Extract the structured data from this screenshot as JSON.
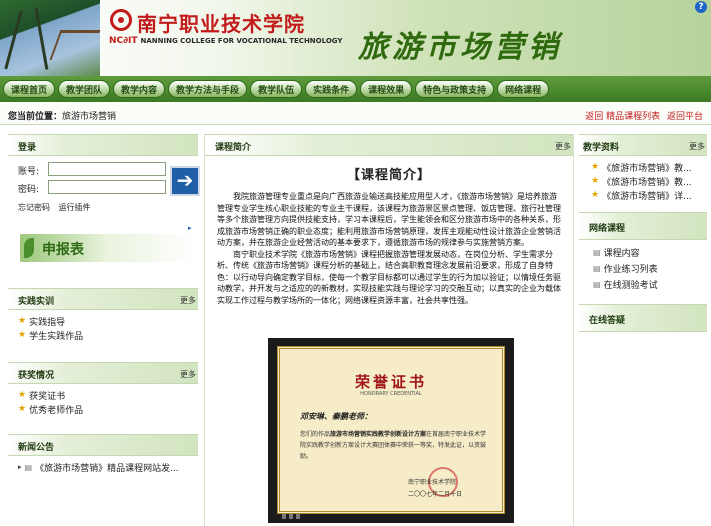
{
  "header": {
    "school_name_cn": "南宁职业技术学院",
    "school_brand": "NC∂IT",
    "school_name_en": "NANNING COLLEGE FOR VOCATIONAL TECHNOLOGY",
    "course_title": "旅游市场营销",
    "help_label": "?"
  },
  "nav": {
    "items": [
      "课程首页",
      "教学团队",
      "教学内容",
      "教学方法与手段",
      "教学队伍",
      "实践条件",
      "课程效果",
      "特色与政策支持",
      "网络课程"
    ]
  },
  "location": {
    "label": "您当前位置：",
    "current": "旅游市场营销",
    "links": [
      "返回 精品课程列表",
      "返回平台"
    ]
  },
  "login": {
    "title": "登录",
    "username_label": "账号:",
    "password_label": "密码:",
    "username_value": "",
    "password_value": "",
    "go_label": "➔",
    "links": [
      "忘记密码",
      "运行插件"
    ]
  },
  "apply": {
    "label": "申报表",
    "arrow": "▸"
  },
  "practice": {
    "title": "实践实训",
    "more": "更多",
    "items": [
      "实践指导",
      "学生实践作品"
    ]
  },
  "awards": {
    "title": "获奖情况",
    "more": "更多",
    "items": [
      "获奖证书",
      "优秀老师作品"
    ]
  },
  "news": {
    "title": "新闻公告",
    "items": [
      "《旅游市场营销》精品课程网站发..."
    ]
  },
  "intro": {
    "panel_title": "课程简介",
    "more": "更多",
    "heading": "【课程简介】",
    "paragraphs": [
      "我院旅游管理专业重点是向广西旅游业输送高技能应用型人才，《旅游市场营销》是培养旅游管理专业学生核心职业技能的专业主干课程，该课程为旅游景区景点管理、饭店管理、旅行社管理等多个旅游管理方向提供技能支持，学习本课程后，学生能领会和区分旅游市场中的各种关系，形成旅游市场营销正确的职业态度；能利用旅游市场营销原理，发挥主观能动性设计旅游企业营销活动方案，并在旅游企业经营活动的基本要求下，遵循旅游市场的规律参与实施营销方案。",
      "南宁职业技术学院《旅游市场营销》课程把握旅游管理发展动态，在岗位分析、学生需求分析、传统《旅游市场营销》课程分析的基础上，结合高职教育理念发展前沿要求，形成了自身特色：以行动导向确定教学目标，使每一个教学目标都可以通过学生的行为加以验证；以情境任务驱动教学，并开发与之适应的的新教材，实现技能实践与理论学习的交融互动；以真实的企业为载体实现工作过程与教学场所的一体化；网络课程资源丰富，社会共享性强。"
    ]
  },
  "certificate": {
    "title": "荣誉证书",
    "subtitle": "HONORARY CREDENTIAL",
    "names": "邓安琳、秦鹏老师：",
    "body_prefix": "您们的作品",
    "body_work": "旅游市场营销实践教学创新设计方案",
    "body_rest": "在首届南宁职业技术学院实践教学创新方案设计大赛团体赛中荣获一等奖，特发此证，以资鼓励。",
    "org": "南宁职业技术学院",
    "date": "二〇〇七年二月十日"
  },
  "resources": {
    "title": "教学资料",
    "more": "更多",
    "items": [
      "《旅游市场营销》教...",
      "《旅游市场营销》教...",
      "《旅游市场营销》详..."
    ]
  },
  "online": {
    "title": "网络课程",
    "items": [
      "课程内容",
      "作业练习列表",
      "在线测验考试"
    ]
  },
  "online_help": {
    "title": "在线答疑"
  },
  "colors": {
    "nav_green": "#3b7a22",
    "title_red": "#c21b1b",
    "course_green": "#2f6a0f",
    "link_red": "#c21b1b"
  }
}
